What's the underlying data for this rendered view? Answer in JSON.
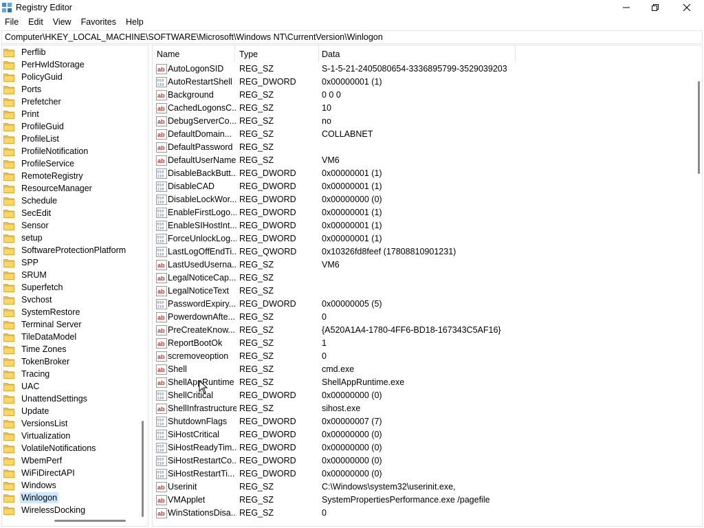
{
  "window": {
    "title": "Registry Editor",
    "minimize_icon": "minimize-icon",
    "maximize_icon": "maximize-icon",
    "close_icon": "close-icon"
  },
  "menu": [
    "File",
    "Edit",
    "View",
    "Favorites",
    "Help"
  ],
  "address": "Computer\\HKEY_LOCAL_MACHINE\\SOFTWARE\\Microsoft\\Windows NT\\CurrentVersion\\Winlogon",
  "tree": {
    "items": [
      "Perflib",
      "PerHwIdStorage",
      "PolicyGuid",
      "Ports",
      "Prefetcher",
      "Print",
      "ProfileGuid",
      "ProfileList",
      "ProfileNotification",
      "ProfileService",
      "RemoteRegistry",
      "ResourceManager",
      "Schedule",
      "SecEdit",
      "Sensor",
      "setup",
      "SoftwareProtectionPlatform",
      "SPP",
      "SRUM",
      "Superfetch",
      "Svchost",
      "SystemRestore",
      "Terminal Server",
      "TileDataModel",
      "Time Zones",
      "TokenBroker",
      "Tracing",
      "UAC",
      "UnattendSettings",
      "Update",
      "VersionsList",
      "Virtualization",
      "VolatileNotifications",
      "WbemPerf",
      "WiFiDirectAPI",
      "Windows",
      "Winlogon",
      "WirelessDocking"
    ],
    "selected": "Winlogon"
  },
  "columns": {
    "name": "Name",
    "type": "Type",
    "data": "Data"
  },
  "values": [
    {
      "name": "AutoLogonSID",
      "type": "REG_SZ",
      "data": "S-1-5-21-2405080654-3336895799-3529039203",
      "icon": "string"
    },
    {
      "name": "AutoRestartShell",
      "type": "REG_DWORD",
      "data": "0x00000001 (1)",
      "icon": "binary"
    },
    {
      "name": "Background",
      "type": "REG_SZ",
      "data": "0 0 0",
      "icon": "string"
    },
    {
      "name": "CachedLogonsC...",
      "type": "REG_SZ",
      "data": "10",
      "icon": "string"
    },
    {
      "name": "DebugServerCo...",
      "type": "REG_SZ",
      "data": "no",
      "icon": "string"
    },
    {
      "name": "DefaultDomain...",
      "type": "REG_SZ",
      "data": "COLLABNET",
      "icon": "string"
    },
    {
      "name": "DefaultPassword",
      "type": "REG_SZ",
      "data": "",
      "icon": "string"
    },
    {
      "name": "DefaultUserName",
      "type": "REG_SZ",
      "data": "VM6",
      "icon": "string"
    },
    {
      "name": "DisableBackButt...",
      "type": "REG_DWORD",
      "data": "0x00000001 (1)",
      "icon": "binary"
    },
    {
      "name": "DisableCAD",
      "type": "REG_DWORD",
      "data": "0x00000001 (1)",
      "icon": "binary"
    },
    {
      "name": "DisableLockWor...",
      "type": "REG_DWORD",
      "data": "0x00000000 (0)",
      "icon": "binary"
    },
    {
      "name": "EnableFirstLogo...",
      "type": "REG_DWORD",
      "data": "0x00000001 (1)",
      "icon": "binary"
    },
    {
      "name": "EnableSIHostInt...",
      "type": "REG_DWORD",
      "data": "0x00000001 (1)",
      "icon": "binary"
    },
    {
      "name": "ForceUnlockLog...",
      "type": "REG_DWORD",
      "data": "0x00000001 (1)",
      "icon": "binary"
    },
    {
      "name": "LastLogOffEndTi...",
      "type": "REG_QWORD",
      "data": "0x10326fd8feef (17808810901231)",
      "icon": "binary"
    },
    {
      "name": "LastUsedUserna...",
      "type": "REG_SZ",
      "data": "VM6",
      "icon": "string"
    },
    {
      "name": "LegalNoticeCap...",
      "type": "REG_SZ",
      "data": "",
      "icon": "string"
    },
    {
      "name": "LegalNoticeText",
      "type": "REG_SZ",
      "data": "",
      "icon": "string"
    },
    {
      "name": "PasswordExpiry...",
      "type": "REG_DWORD",
      "data": "0x00000005 (5)",
      "icon": "binary"
    },
    {
      "name": "PowerdownAfte...",
      "type": "REG_SZ",
      "data": "0",
      "icon": "string"
    },
    {
      "name": "PreCreateKnow...",
      "type": "REG_SZ",
      "data": "{A520A1A4-1780-4FF6-BD18-167343C5AF16}",
      "icon": "string"
    },
    {
      "name": "ReportBootOk",
      "type": "REG_SZ",
      "data": "1",
      "icon": "string"
    },
    {
      "name": "scremoveoption",
      "type": "REG_SZ",
      "data": "0",
      "icon": "string"
    },
    {
      "name": "Shell",
      "type": "REG_SZ",
      "data": "cmd.exe",
      "icon": "string"
    },
    {
      "name": "ShellAppRuntime",
      "type": "REG_SZ",
      "data": "ShellAppRuntime.exe",
      "icon": "string"
    },
    {
      "name": "ShellCritical",
      "type": "REG_DWORD",
      "data": "0x00000000 (0)",
      "icon": "binary"
    },
    {
      "name": "ShellInfrastructure",
      "type": "REG_SZ",
      "data": "sihost.exe",
      "icon": "string"
    },
    {
      "name": "ShutdownFlags",
      "type": "REG_DWORD",
      "data": "0x00000007 (7)",
      "icon": "binary"
    },
    {
      "name": "SiHostCritical",
      "type": "REG_DWORD",
      "data": "0x00000000 (0)",
      "icon": "binary"
    },
    {
      "name": "SiHostReadyTim...",
      "type": "REG_DWORD",
      "data": "0x00000000 (0)",
      "icon": "binary"
    },
    {
      "name": "SiHostRestartCo...",
      "type": "REG_DWORD",
      "data": "0x00000000 (0)",
      "icon": "binary"
    },
    {
      "name": "SiHostRestartTi...",
      "type": "REG_DWORD",
      "data": "0x00000000 (0)",
      "icon": "binary"
    },
    {
      "name": "Userinit",
      "type": "REG_SZ",
      "data": "C:\\Windows\\system32\\userinit.exe,",
      "icon": "string"
    },
    {
      "name": "VMApplet",
      "type": "REG_SZ",
      "data": "SystemPropertiesPerformance.exe /pagefile",
      "icon": "string"
    },
    {
      "name": "WinStationsDisa...",
      "type": "REG_SZ",
      "data": "0",
      "icon": "string"
    }
  ],
  "colors": {
    "folder": "#f5c542",
    "folder_dark": "#e0a82e",
    "selection": "#cce8ff",
    "string_icon": "#c0392b",
    "binary_icon": "#2b5fa8"
  }
}
